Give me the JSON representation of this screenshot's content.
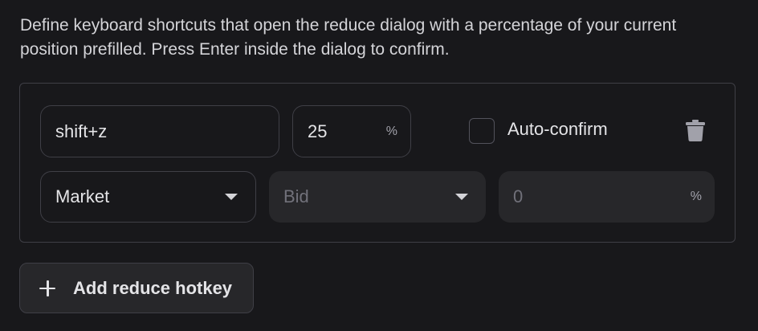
{
  "description": "Define keyboard shortcuts that open the reduce dialog with a percentage of your current position prefilled. Press Enter inside the dialog to confirm.",
  "hotkey_row": {
    "shortcut": "shift+z",
    "percent_value": "25",
    "percent_suffix": "%",
    "auto_confirm_label": "Auto-confirm",
    "auto_confirm_checked": false,
    "delete_icon": "trash-icon",
    "order_type": "Market",
    "price_source": "Bid",
    "offset_value": "0",
    "offset_suffix": "%"
  },
  "add_button": {
    "label": "Add reduce hotkey",
    "icon": "plus-icon"
  }
}
